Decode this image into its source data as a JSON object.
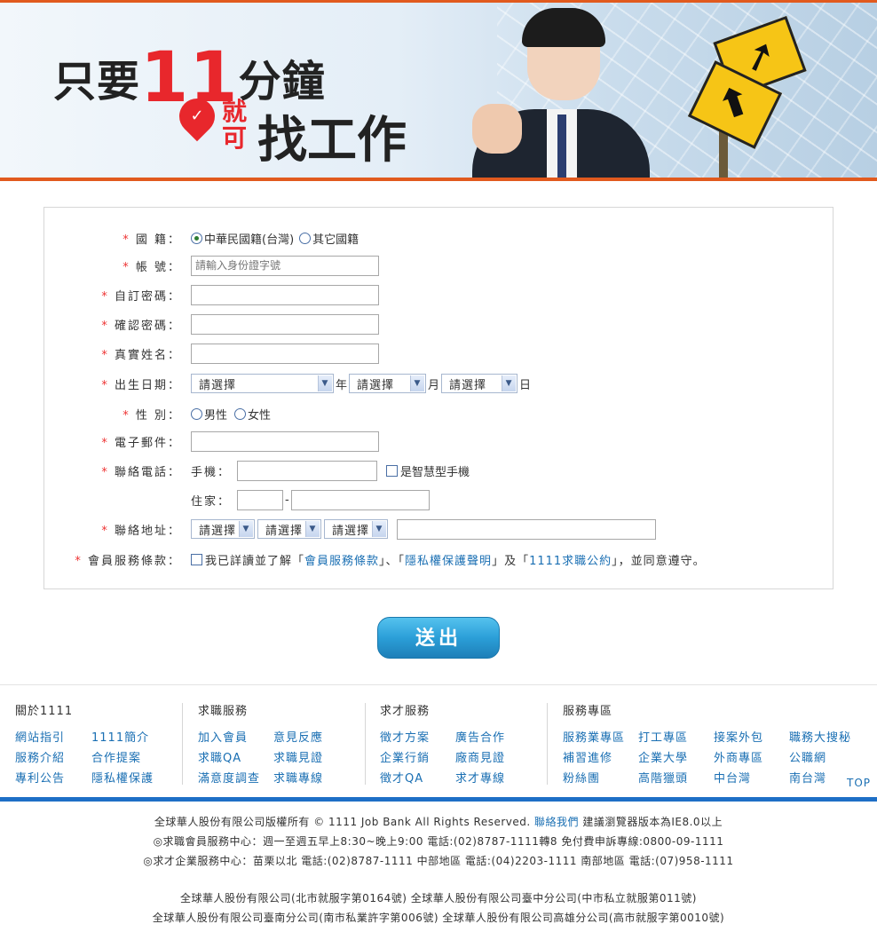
{
  "banner": {
    "slogan_prefix": "只要",
    "slogan_number": "11",
    "slogan_unit": "分鐘",
    "slogan_jiu": "就可",
    "slogan_main": "找工作"
  },
  "form": {
    "nationality": {
      "label": "國 籍：",
      "option1": "中華民國籍(台灣)",
      "option2": "其它國籍"
    },
    "account": {
      "label": "帳 號：",
      "placeholder": "請輸入身份證字號"
    },
    "password": {
      "label": "自訂密碼："
    },
    "confirm_password": {
      "label": "確認密碼："
    },
    "real_name": {
      "label": "真實姓名："
    },
    "birthday": {
      "label": "出生日期：",
      "year": "請選擇",
      "year_unit": "年",
      "month": "請選擇",
      "month_unit": "月",
      "day": "請選擇",
      "day_unit": "日"
    },
    "gender": {
      "label": "性 別：",
      "male": "男性",
      "female": "女性"
    },
    "email": {
      "label": "電子郵件："
    },
    "phone": {
      "label": "聯絡電話：",
      "mobile_label": "手機：",
      "smartphone": "是智慧型手機",
      "home_label": "住家：",
      "dash": "-"
    },
    "address": {
      "label": "聯絡地址：",
      "sel1": "請選擇",
      "sel2": "請選擇",
      "sel3": "請選擇"
    },
    "terms": {
      "label": "會員服務條款：",
      "pre": "我已詳讀並了解「",
      "link1": "會員服務條款",
      "mid1": "」、「",
      "link2": "隱私權保護聲明",
      "mid2": "」及「",
      "link3": "1111求職公約",
      "post": "」，並同意遵守。"
    },
    "required_mark": "*"
  },
  "submit_label": "送出",
  "footer": {
    "col1": {
      "title": "關於1111",
      "items": [
        "網站指引",
        "1111簡介",
        "服務介紹",
        "合作提案",
        "專利公告",
        "隱私權保護"
      ]
    },
    "col2": {
      "title": "求職服務",
      "items": [
        "加入會員",
        "意見反應",
        "求職QA",
        "求職見證",
        "滿意度調查",
        "求職專線"
      ]
    },
    "col3": {
      "title": "求才服務",
      "items": [
        "徵才方案",
        "廣告合作",
        "企業行銷",
        "廠商見證",
        "徵才QA",
        "求才專線"
      ]
    },
    "col4": {
      "title": "服務專區",
      "items": [
        "服務業專區",
        "打工專區",
        "接案外包",
        "職務大搜秘",
        "補習進修",
        "企業大學",
        "外商專區",
        "公職網",
        "粉絲團",
        "高階獵頭",
        "中台灣",
        "南台灣"
      ]
    },
    "top": "TOP"
  },
  "copyright": {
    "line1_pre": "全球華人股份有限公司版權所有 © 1111 Job Bank All Rights Reserved.",
    "line1_link": "聯絡我們",
    "line1_post": "建議瀏覽器版本為IE8.0以上",
    "line2": "◎求職會員服務中心：週一至週五早上8:30~晚上9:00 電話:(02)8787-1111轉8 免付費申訴專線:0800-09-1111",
    "line3": "◎求才企業服務中心：苗栗以北 電話:(02)8787-1111 中部地區 電話:(04)2203-1111 南部地區 電話:(07)958-1111",
    "line4": "全球華人股份有限公司(北市就服字第0164號) 全球華人股份有限公司臺中分公司(中市私立就服第011號)",
    "line5": "全球華人股份有限公司臺南分公司(南市私業許字第006號) 全球華人股份有限公司高雄分公司(高市就服字第0010號)"
  }
}
